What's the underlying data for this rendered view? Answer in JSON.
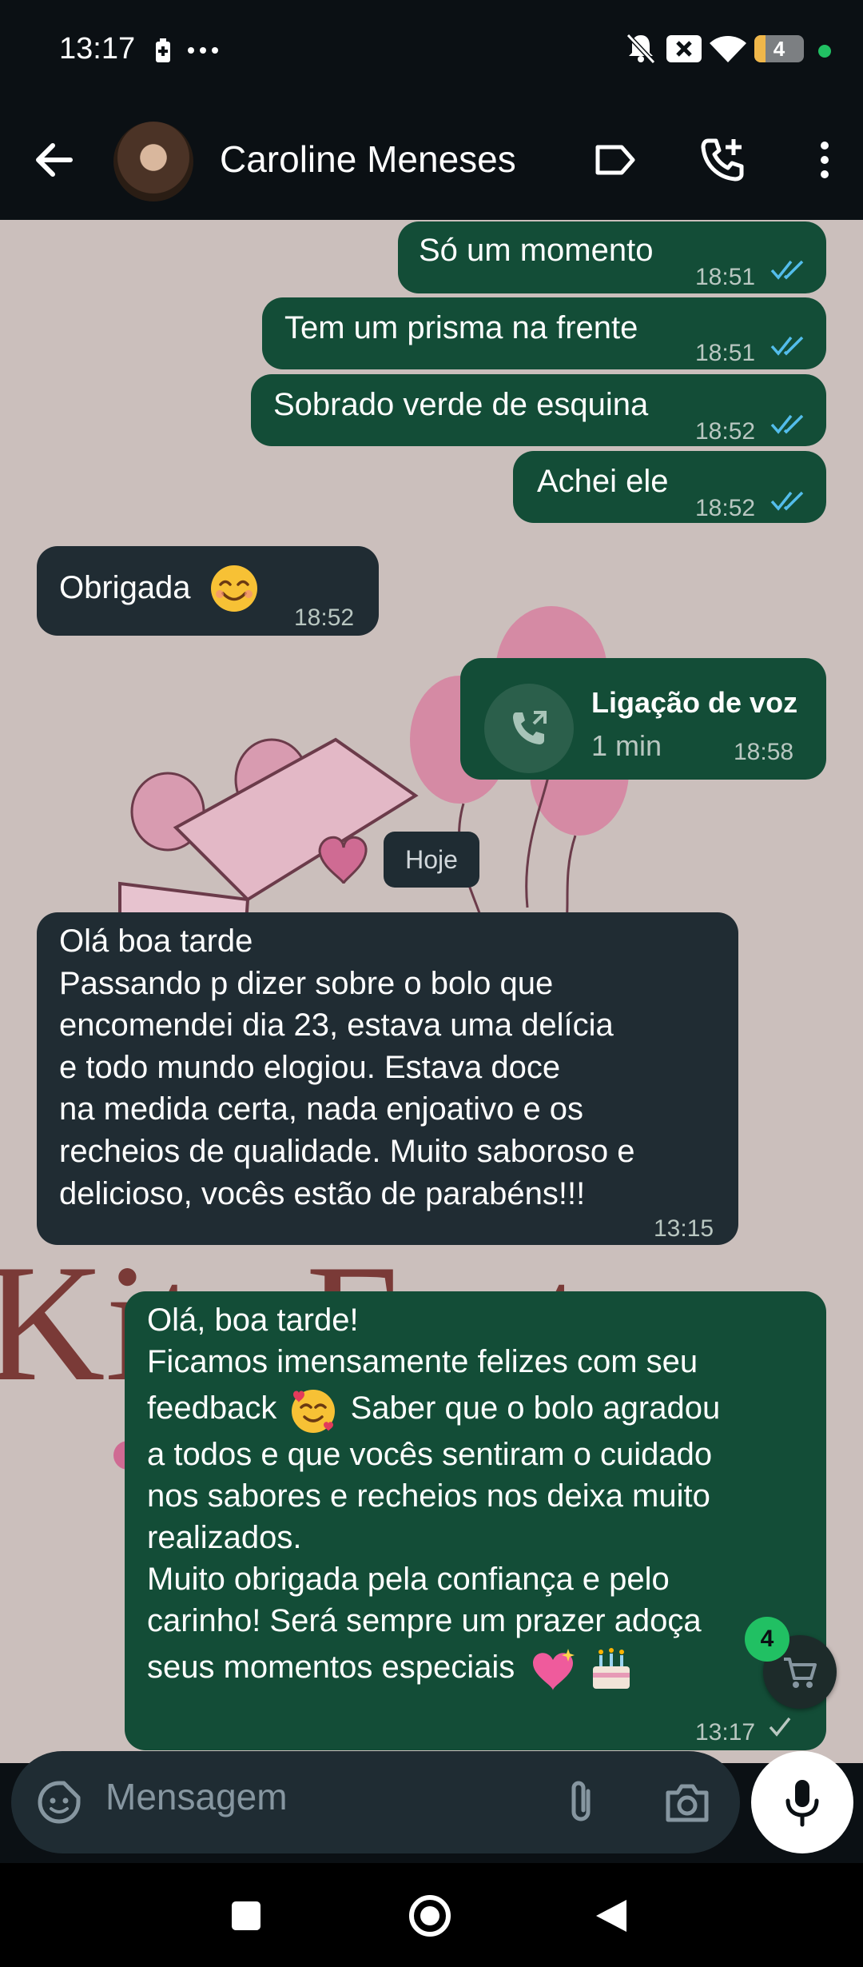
{
  "status": {
    "time": "13:17",
    "battery": "4"
  },
  "header": {
    "contact_name": "Caroline Meneses"
  },
  "messages": [
    {
      "dir": "out",
      "text": "Só um momento",
      "time": "18:51"
    },
    {
      "dir": "out",
      "text": "Tem um prisma na frente",
      "time": "18:51"
    },
    {
      "dir": "out",
      "text": "Sobrado verde de esquina",
      "time": "18:52"
    },
    {
      "dir": "out",
      "text": "Achei ele",
      "time": "18:52"
    },
    {
      "dir": "in",
      "text": "Obrigada",
      "time": "18:52"
    },
    {
      "dir": "out",
      "call_title": "Ligação de voz",
      "call_duration": "1 min",
      "time": "18:58"
    },
    {
      "dir": "in",
      "lines": [
        "Olá boa tarde",
        "Passando p dizer sobre o bolo que",
        "encomendei dia 23, estava uma delícia",
        "e todo mundo elogiou. Estava doce",
        "na medida certa, nada enjoativo e os",
        "recheios de qualidade.  Muito saboroso e",
        "delicioso, vocês estão de parabéns!!!"
      ],
      "time": "13:15"
    },
    {
      "dir": "out",
      "lines": [
        "Olá, boa tarde!",
        "Ficamos imensamente felizes com seu",
        "feedback",
        "Saber que o bolo agradou",
        "a todos e que vocês sentiram o cuidado",
        "nos sabores e recheios nos deixa muito",
        "realizados.",
        "Muito obrigada pela confiança e pelo",
        "carinho! Será sempre um prazer adoça",
        "seus momentos especiais"
      ],
      "time": "13:17"
    }
  ],
  "day_divider": "Hoje",
  "cart_badge": "4",
  "input": {
    "placeholder": "Mensagem"
  },
  "colors": {
    "outgoing_bubble": "#134d37",
    "incoming_bubble": "#202c33",
    "read_ticks": "#53bdeb",
    "accent_green": "#21c063"
  }
}
